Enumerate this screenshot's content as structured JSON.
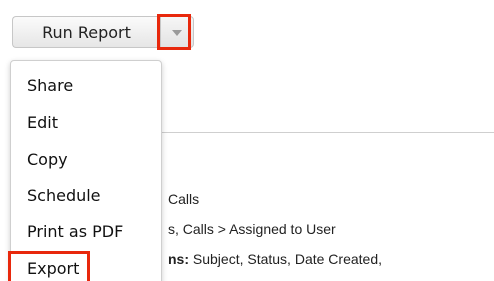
{
  "toolbar": {
    "run_report_label": "Run Report"
  },
  "dropdown": {
    "items": [
      "Share",
      "Edit",
      "Copy",
      "Schedule",
      "Print as PDF",
      "Export"
    ]
  },
  "report_details": {
    "line1": "Calls",
    "line2": "s, Calls > Assigned to User",
    "line3_label": "ns:",
    "line3_value": " Subject, Status, Date Created,"
  },
  "colors": {
    "highlight": "#e8280c"
  }
}
